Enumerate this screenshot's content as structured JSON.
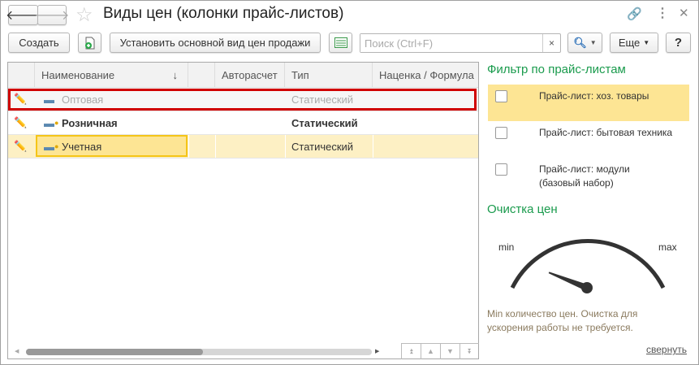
{
  "window": {
    "title": "Виды цен (колонки прайс-листов)"
  },
  "toolbar": {
    "create": "Создать",
    "set_main": "Установить основной вид цен продажи",
    "search_placeholder": "Поиск (Ctrl+F)",
    "search_value": "",
    "clear": "×",
    "more": "Еще",
    "help": "?"
  },
  "table": {
    "columns": [
      "Наименование",
      "",
      "Авторасчет",
      "Тип",
      "Наценка / Формула"
    ],
    "sort_indicator": "↓",
    "rows": [
      {
        "name": "Оптовая",
        "auto": "",
        "type": "Статический",
        "markup": "",
        "state": "disabled"
      },
      {
        "name": "Розничная",
        "auto": "",
        "type": "Статический",
        "markup": "",
        "state": "bold"
      },
      {
        "name": "Учетная",
        "auto": "",
        "type": "Статический",
        "markup": "",
        "state": "selected"
      }
    ]
  },
  "filter": {
    "title": "Фильтр по прайс-листам",
    "items": [
      {
        "label": "Прайс-лист: хоз. товары",
        "checked": false
      },
      {
        "label": "Прайс-лист: бытовая техника",
        "checked": false
      },
      {
        "label": "Прайс-лист: модули (базовый набор)",
        "checked": false
      }
    ]
  },
  "cleanup": {
    "title": "Очистка цен",
    "min": "min",
    "max": "max",
    "gauge_value": 0.2,
    "message": "Min количество цен. Очистка для ускорения работы не требуется.",
    "collapse": "свернуть"
  },
  "colors": {
    "accent_green": "#1a9b4d",
    "highlight": "#fde594",
    "selected_row": "#fdf0c4",
    "error_outline": "#d00000"
  }
}
